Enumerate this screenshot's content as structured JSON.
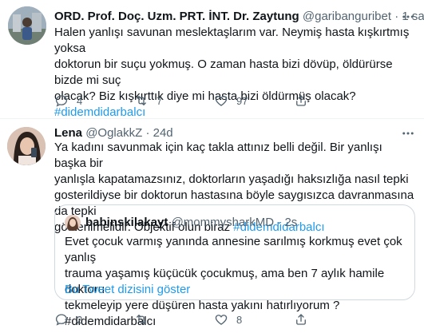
{
  "tweet1": {
    "display_name": "ORD. Prof. Doç. Uzm. PRT. İNT. Dr. Zaytung",
    "handle": "@garibanguribet",
    "separator": "·",
    "time": "1 sa",
    "lines": [
      "Halen yanlışı savunan meslektaşlarım var. Neymiş hasta kışkırtmış yoksa",
      "doktorun bir suçu yokmuş. O zaman hasta bizi dövüp, öldürürse bizde mi suç",
      "olacak? Biz kışkırttık diye mi hasta bizi öldürmüş olacak?"
    ],
    "hashtag": "#didemdidarbalcı",
    "reply_count": "4",
    "retweet_count": "7",
    "like_count": "97"
  },
  "tweet2": {
    "display_name": "Lena",
    "handle": "@OglakkZ",
    "separator": "·",
    "time": "24d",
    "lines": [
      "Ya kadını savunmak için kaç takla attınız belli değil. Bir yanlışı başka bir",
      "yanlışla kapatamazsınız, doktorların yaşadığı haksızlığa nasıl tepki",
      "gosterildiyse bir doktorun hastasına böyle saygısızca davranmasına da tepki",
      "gösterilmelidir. Objektif olun biraz "
    ],
    "hashtag": "#didemdidarbalcı",
    "reply_count": "2",
    "retweet_count": "",
    "like_count": "8",
    "quote": {
      "display_name": "babinskilakayt",
      "handle": "@mommysharkMD",
      "separator": "·",
      "time": "2s",
      "lines": [
        "Evet çocuk varmış yanında annesine sarılmış korkmuş evet çok yanlış",
        "trauma yaşamış küçücük çocukmuş, ama ben 7 aylık hamile doktoru",
        "tekmeleyip yere düşüren hasta yakını hatırlıyorum ? #didemdidarbalcı"
      ],
      "thread_link": "Bu Tweet dizisini göster"
    }
  },
  "colors": {
    "link_blue": "#1d9bf0",
    "text_primary": "#0f1419",
    "text_secondary": "#536471",
    "border": "#cfd9de"
  },
  "icons": [
    "more-icon",
    "reply-icon",
    "retweet-icon",
    "like-icon",
    "share-icon"
  ]
}
